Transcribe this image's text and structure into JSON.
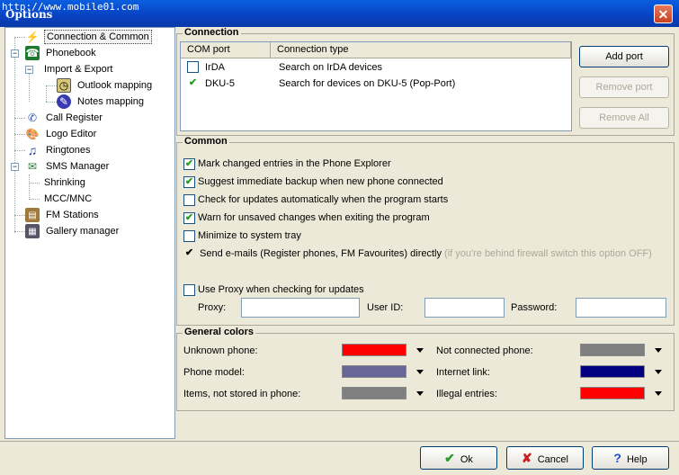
{
  "window": {
    "title": "Options",
    "watermark": "http://www.mobile01.com"
  },
  "tree": [
    {
      "label": "Connection & Common",
      "icon": "plug-icon",
      "selected": true
    },
    {
      "label": "Phonebook",
      "icon": "phonebook-icon"
    },
    {
      "label": "Import & Export"
    },
    {
      "label": "Outlook mapping",
      "icon": "outlook-icon"
    },
    {
      "label": "Notes mapping",
      "icon": "notes-icon"
    },
    {
      "label": "Call Register",
      "icon": "call-register-icon"
    },
    {
      "label": "Logo Editor",
      "icon": "palette-icon"
    },
    {
      "label": "Ringtones",
      "icon": "music-note-icon"
    },
    {
      "label": "SMS Manager",
      "icon": "sms-icon"
    },
    {
      "label": "Shrinking"
    },
    {
      "label": "MCC/MNC"
    },
    {
      "label": "FM Stations",
      "icon": "radio-icon"
    },
    {
      "label": "Gallery manager",
      "icon": "gallery-icon"
    }
  ],
  "connection": {
    "title": "Connection",
    "columns": [
      "COM port",
      "Connection type"
    ],
    "rows": [
      {
        "port": "IrDA",
        "type": "Search on IrDA devices",
        "checked": false
      },
      {
        "port": "DKU-5",
        "type": "Search for devices on DKU-5 (Pop-Port)",
        "checked": true
      }
    ],
    "add_port": "Add port",
    "remove_port": "Remove port",
    "remove_all": "Remove All"
  },
  "common": {
    "title": "Common",
    "options": [
      {
        "label": "Mark changed entries in the Phone Explorer",
        "checked": true
      },
      {
        "label": "Suggest immediate backup when new phone connected",
        "checked": true
      },
      {
        "label": "Check for updates automatically when the program starts",
        "checked": false
      },
      {
        "label": "Warn for unsaved changes when exiting the program",
        "checked": true
      },
      {
        "label": "Minimize to system tray",
        "checked": false
      },
      {
        "label": "Send e-mails (Register phones, FM Favourites) directly",
        "hint": "(if you're behind firewall switch this option OFF)",
        "checked": true
      }
    ],
    "proxy": {
      "label": "Use Proxy when checking for updates",
      "checked": false,
      "proxy_label": "Proxy:",
      "user_label": "User ID:",
      "password_label": "Password:",
      "proxy_value": "",
      "user_value": "",
      "password_value": ""
    }
  },
  "colors": {
    "title": "General colors",
    "items": [
      {
        "label": "Unknown phone:",
        "color": "#ff0000"
      },
      {
        "label": "Phone model:",
        "color": "#666699"
      },
      {
        "label": "Items, not stored in phone:",
        "color": "#808080"
      },
      {
        "label": "Not connected phone:",
        "color": "#808080"
      },
      {
        "label": "Internet link:",
        "color": "#000080"
      },
      {
        "label": "Illegal entries:",
        "color": "#ff0000"
      }
    ]
  },
  "buttons": {
    "ok": "Ok",
    "cancel": "Cancel",
    "help": "Help"
  }
}
